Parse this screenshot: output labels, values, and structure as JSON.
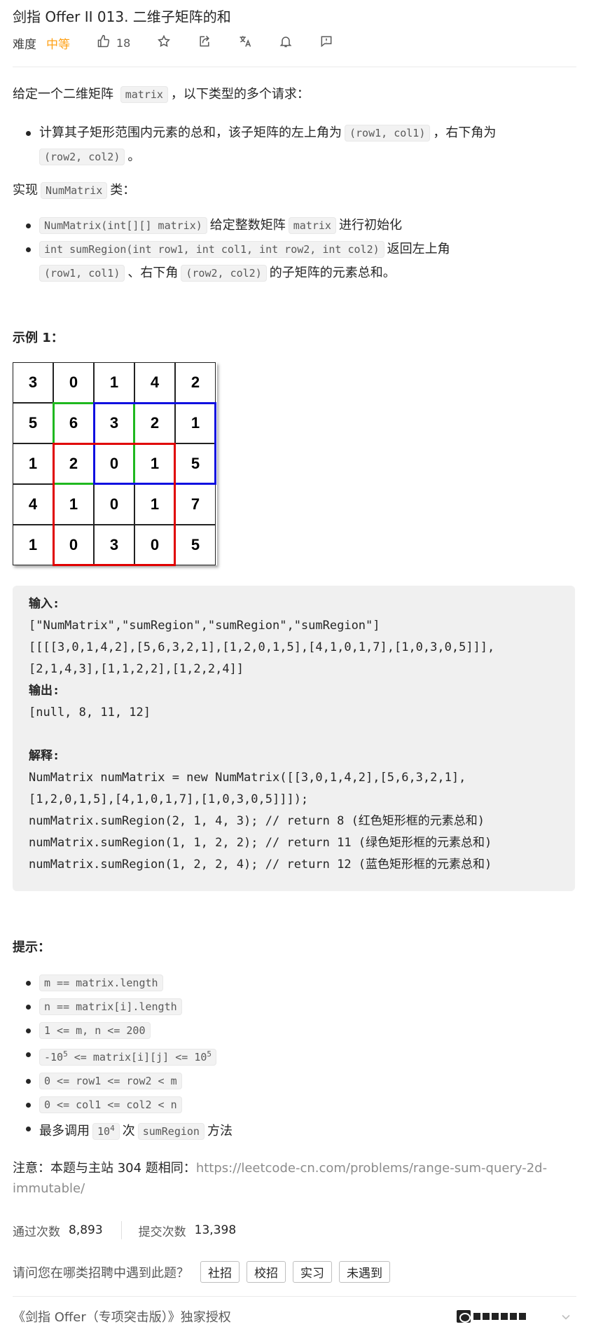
{
  "header": {
    "title": "剑指 Offer II 013. 二维子矩阵的和",
    "difficulty_label": "难度",
    "difficulty_value": "中等",
    "like_count": "18",
    "icons": [
      "thumbs-up-icon",
      "star-icon",
      "share-icon",
      "translate-icon",
      "bell-icon",
      "feedback-icon"
    ]
  },
  "description": {
    "intro_before": "给定一个二维矩阵 ",
    "intro_code": "matrix",
    "intro_after": "，以下类型的多个请求：",
    "bullet1_text": "计算其子矩形范围内元素的总和，该子矩阵的左上角为",
    "bullet1_code1": "(row1, col1)",
    "bullet1_mid": "，右下角为",
    "bullet1_code2": "(row2, col2)",
    "bullet1_end": "。",
    "impl_before": "实现",
    "impl_code": "NumMatrix",
    "impl_after": "类：",
    "b2_code1": "NumMatrix(int[][] matrix)",
    "b2_text": "给定整数矩阵",
    "b2_code2": "matrix",
    "b2_after": "进行初始化",
    "b3_code1": "int sumRegion(int row1, int col1, int row2, int col2)",
    "b3_text": "返回左上角",
    "b3_code2": "(row1, col1)",
    "b3_mid": "、右下角",
    "b3_code3": "(row2, col2)",
    "b3_end": "的子矩阵的元素总和。"
  },
  "example": {
    "heading": "示例 1：",
    "matrix": [
      [
        3,
        0,
        1,
        4,
        2
      ],
      [
        5,
        6,
        3,
        2,
        1
      ],
      [
        1,
        2,
        0,
        1,
        5
      ],
      [
        4,
        1,
        0,
        1,
        7
      ],
      [
        1,
        0,
        3,
        0,
        5
      ]
    ],
    "colors": {
      "red": "#e00000",
      "green": "#1fb81f",
      "blue": "#1010e0"
    },
    "input_label": "输入:",
    "input_line1": "[\"NumMatrix\",\"sumRegion\",\"sumRegion\",\"sumRegion\"]",
    "input_line2": "[[[[3,0,1,4,2],[5,6,3,2,1],[1,2,0,1,5],[4,1,0,1,7],[1,0,3,0,5]]],",
    "input_line3": "[2,1,4,3],[1,1,2,2],[1,2,2,4]]",
    "output_label": "输出:",
    "output_line": "[null, 8, 11, 12]",
    "explain_label": "解释:",
    "explain_line1": "NumMatrix numMatrix = new NumMatrix([[3,0,1,4,2],[5,6,3,2,1],",
    "explain_line2": "[1,2,0,1,5],[4,1,0,1,7],[1,0,3,0,5]]]);",
    "explain_line3": "numMatrix.sumRegion(2, 1, 4, 3); // return 8 (红色矩形框的元素总和)",
    "explain_line4": "numMatrix.sumRegion(1, 1, 2, 2); // return 11 (绿色矩形框的元素总和)",
    "explain_line5": "numMatrix.sumRegion(1, 2, 2, 4); // return 12 (蓝色矩形框的元素总和)"
  },
  "hints": {
    "heading": "提示：",
    "h1": "m == matrix.length",
    "h2": "n == matrix[i].length",
    "h3": "1 <= m, n <= 200",
    "h4_a": "-10",
    "h4_sup1": "5",
    "h4_b": " <= matrix[i][j] <= 10",
    "h4_sup2": "5",
    "h5": "0 <= row1 <= row2 < m",
    "h6": "0 <= col1 <= col2 < n",
    "h7_before": "最多调用",
    "h7_code_a": "10",
    "h7_code_sup": "4",
    "h7_mid": "次",
    "h7_code2": "sumRegion",
    "h7_after": "方法"
  },
  "note": {
    "prefix": "注意：本题与主站 304 题相同：",
    "link": "https://leetcode-cn.com/problems/range-sum-query-2d-immutable/"
  },
  "stats": {
    "accepted_label": "通过次数",
    "accepted_value": "8,893",
    "submitted_label": "提交次数",
    "submitted_value": "13,398"
  },
  "survey": {
    "question": "请问您在哪类招聘中遇到此题？",
    "options": [
      "社招",
      "校招",
      "实习",
      "未遇到"
    ]
  },
  "footer": {
    "text": "《剑指 Offer（专项突击版）》独家授权"
  }
}
